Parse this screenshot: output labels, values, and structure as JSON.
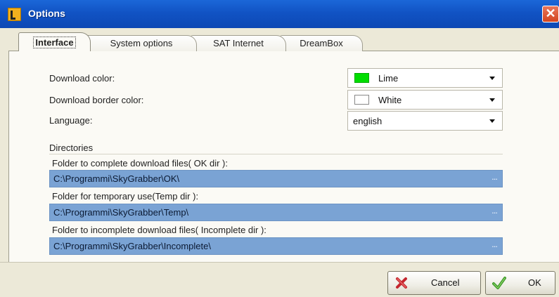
{
  "window": {
    "title": "Options",
    "close_glyph": "✕"
  },
  "tabs": [
    {
      "label": "Interface",
      "active": true
    },
    {
      "label": "System options",
      "active": false
    },
    {
      "label": "SAT Internet",
      "active": false
    },
    {
      "label": "DreamBox",
      "active": false
    }
  ],
  "interface": {
    "download_color": {
      "label": "Download color:",
      "value": "Lime",
      "swatch": "#00dd00"
    },
    "download_border_color": {
      "label": "Download border color:",
      "value": "White",
      "swatch": "#ffffff"
    },
    "language": {
      "label": "Language:",
      "value": "english"
    }
  },
  "directories": {
    "heading": "Directories",
    "browse_label": "...",
    "items": [
      {
        "label": "Folder to complete download files( OK dir ):",
        "path": "C:\\Programmi\\SkyGrabber\\OK\\"
      },
      {
        "label": "Folder for temporary use(Temp dir ):",
        "path": "C:\\Programmi\\SkyGrabber\\Temp\\"
      },
      {
        "label": "Folder to incomplete download files( Incomplete dir ):",
        "path": "C:\\Programmi\\SkyGrabber\\Incomplete\\"
      }
    ]
  },
  "buttons": {
    "cancel": {
      "label": "Cancel",
      "icon": "cancel-x-icon"
    },
    "ok": {
      "label": "OK",
      "icon": "check-icon"
    }
  },
  "colors": {
    "titlebar": "#1153c4",
    "path_field": "#7aa3d4"
  }
}
